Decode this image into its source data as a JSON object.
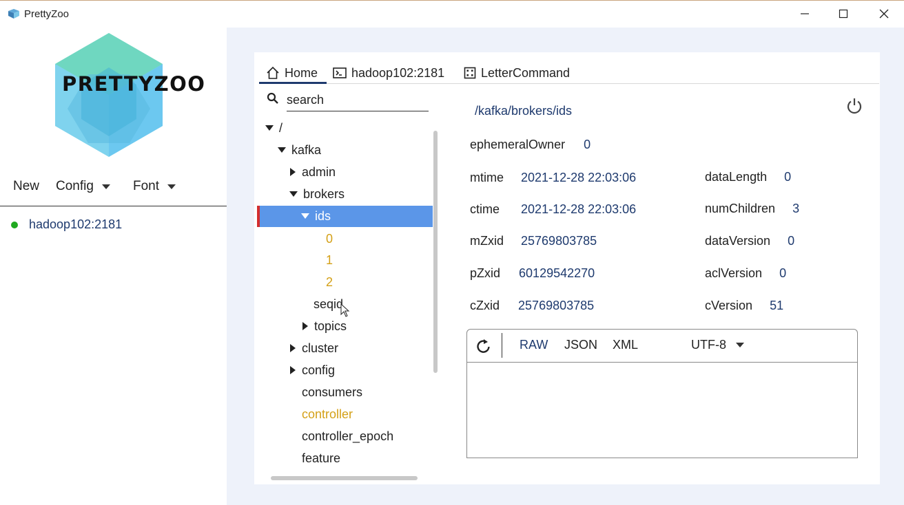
{
  "window": {
    "title": "PrettyZoo",
    "icon": "prettyzoo-app-icon",
    "controls": [
      "minimize-icon",
      "maximize-icon",
      "close-icon"
    ]
  },
  "sidebar": {
    "logo_text": "PRETTYZOO",
    "menu": [
      {
        "label": "New",
        "has_dropdown": false
      },
      {
        "label": "Config",
        "has_dropdown": true
      },
      {
        "label": "Font",
        "has_dropdown": true
      }
    ],
    "servers": [
      {
        "label": "hadoop102:2181",
        "status": "connected",
        "status_color": "#1fa91f"
      }
    ]
  },
  "tabs": [
    {
      "label": "Home",
      "icon": "home-icon",
      "active": true
    },
    {
      "label": "hadoop102:2181",
      "icon": "terminal-icon",
      "active": false
    },
    {
      "label": "LetterCommand",
      "icon": "command-icon",
      "active": false
    }
  ],
  "search": {
    "placeholder": "search",
    "value": ""
  },
  "tree": {
    "root": "/",
    "kafka": "kafka",
    "admin": "admin",
    "brokers": "brokers",
    "ids": "ids",
    "id_0": "0",
    "id_1": "1",
    "id_2": "2",
    "seqid": "seqid",
    "topics": "topics",
    "cluster": "cluster",
    "config": "config",
    "consumers": "consumers",
    "controller": "controller",
    "controller_epoch": "controller_epoch",
    "feature": "feature",
    "selected": "ids",
    "ephemeral_color": "#d4a017",
    "selection_color": "#5b96e8"
  },
  "detail": {
    "path": "/kafka/brokers/ids",
    "ephemeralOwner": {
      "name": "ephemeralOwner",
      "value": "0"
    },
    "mtime": {
      "name": "mtime",
      "value": "2021-12-28 22:03:06"
    },
    "ctime": {
      "name": "ctime",
      "value": "2021-12-28 22:03:06"
    },
    "mZxid": {
      "name": "mZxid",
      "value": "25769803785"
    },
    "pZxid": {
      "name": "pZxid",
      "value": "60129542270"
    },
    "cZxid": {
      "name": "cZxid",
      "value": "25769803785"
    },
    "dataLength": {
      "name": "dataLength",
      "value": "0"
    },
    "numChildren": {
      "name": "numChildren",
      "value": "3"
    },
    "dataVersion": {
      "name": "dataVersion",
      "value": "0"
    },
    "aclVersion": {
      "name": "aclVersion",
      "value": "0"
    },
    "cVersion": {
      "name": "cVersion",
      "value": "51"
    }
  },
  "editor": {
    "formats": [
      "RAW",
      "JSON",
      "XML"
    ],
    "active_format": "RAW",
    "encoding": "UTF-8",
    "content": ""
  },
  "colors": {
    "accent_navy": "#1e3a6e",
    "right_background": "#eef2fa",
    "selection_marker": "#d42e2e"
  }
}
